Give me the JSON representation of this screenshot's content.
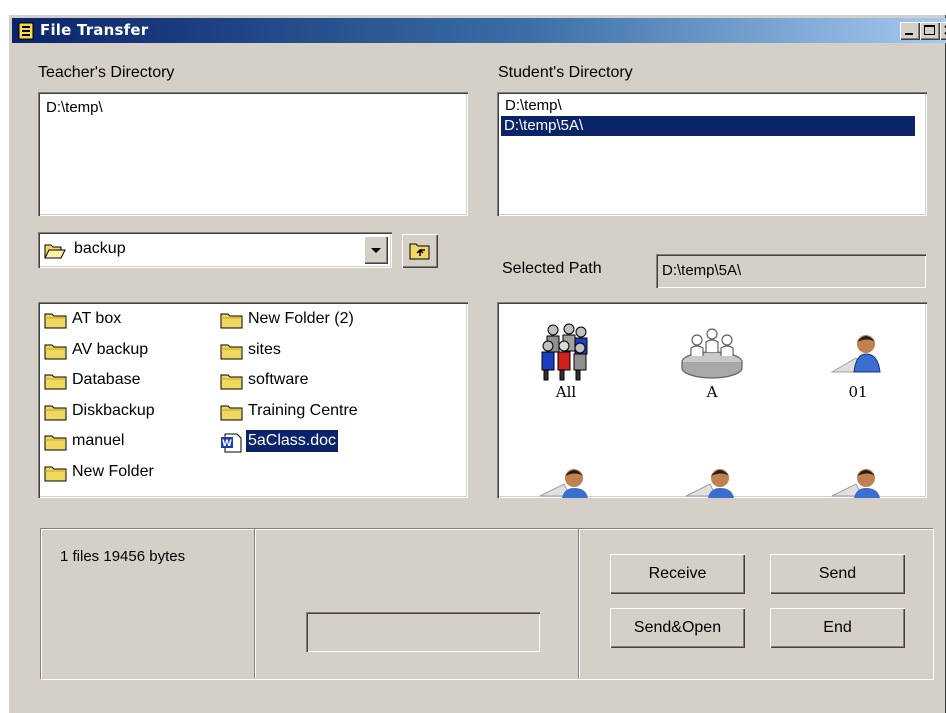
{
  "window": {
    "title": "File Transfer"
  },
  "teacher": {
    "label": "Teacher's Directory",
    "directories": [
      "D:\\temp\\"
    ],
    "folder_combo": {
      "selected": "backup"
    },
    "files": [
      {
        "name": "AT box",
        "type": "folder"
      },
      {
        "name": "AV backup",
        "type": "folder"
      },
      {
        "name": "Database",
        "type": "folder"
      },
      {
        "name": "Diskbackup",
        "type": "folder"
      },
      {
        "name": "manuel",
        "type": "folder"
      },
      {
        "name": "New Folder",
        "type": "folder"
      },
      {
        "name": "New Folder (2)",
        "type": "folder"
      },
      {
        "name": "sites",
        "type": "folder"
      },
      {
        "name": "software",
        "type": "folder"
      },
      {
        "name": "Training Centre",
        "type": "folder"
      },
      {
        "name": "5aClass.doc",
        "type": "word-doc",
        "selected": true
      }
    ]
  },
  "student": {
    "label": "Student's Directory",
    "directories": [
      "D:\\temp\\",
      "D:\\temp\\5A\\"
    ],
    "selected_directory_index": 1,
    "selected_path_label": "Selected Path",
    "selected_path_value": "D:\\temp\\5A\\",
    "groups": [
      {
        "name": "All",
        "icon": "group-people-icon"
      },
      {
        "name": "A",
        "icon": "class-table-icon"
      },
      {
        "name": "01",
        "icon": "student-computer-icon"
      }
    ]
  },
  "status": {
    "file_summary": "1 files 19456 bytes",
    "progress": 0
  },
  "buttons": {
    "receive": "Receive",
    "send": "Send",
    "send_open": "Send&Open",
    "end": "End"
  }
}
